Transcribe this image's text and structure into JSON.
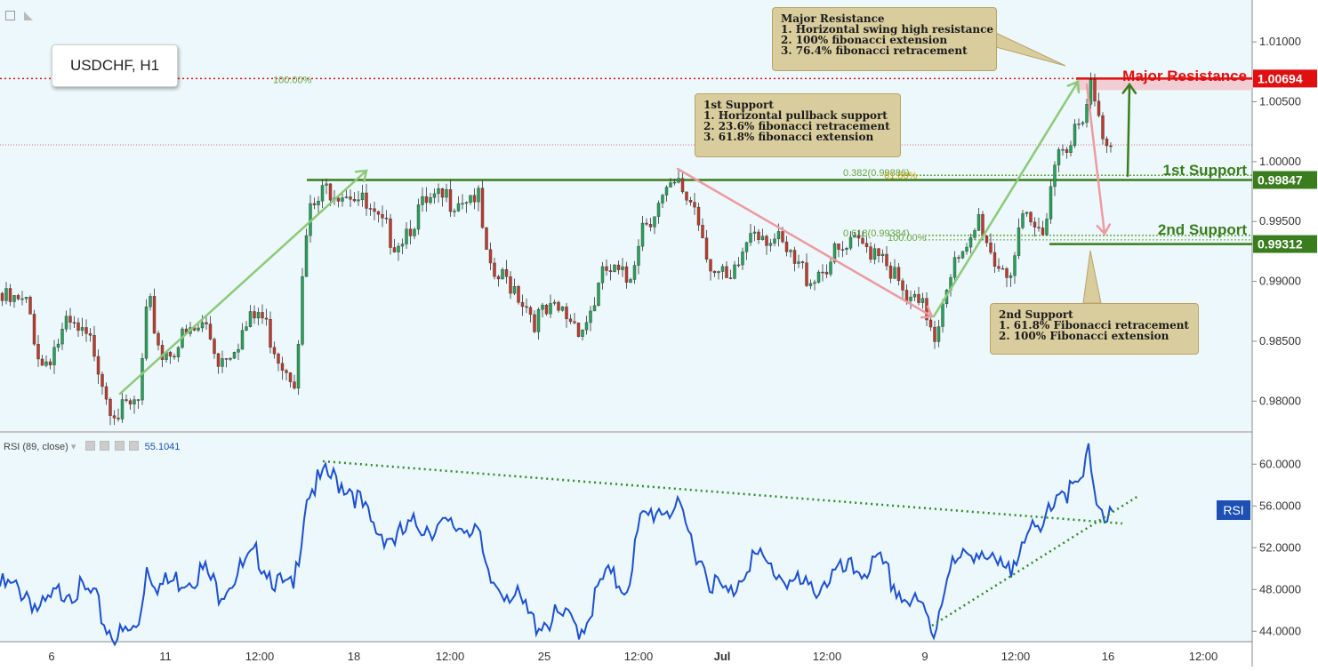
{
  "symbol": "USDCHF, H1",
  "colors": {
    "background": "#ecf8fb",
    "bull": "#26a35a",
    "bear": "#c0392b",
    "support_green": "#3a7d1e",
    "resistance_red": "#e01010",
    "fib_green": "#6aa343",
    "rsi_blue": "#1e50d0",
    "callout_bg": "#d9cc9d"
  },
  "annotations": {
    "major_resistance": {
      "label": "Major Resistance",
      "price_tag": "1.00694",
      "callout_title": "Major Resistance",
      "callout_lines": [
        "1. Horizontal swing high resistance",
        "2. 100% fibonacci extension",
        "3. 76.4% fibonacci retracement"
      ]
    },
    "first_support": {
      "label": "1st Support",
      "price_tag": "0.99847",
      "callout_title": "1st Support",
      "callout_lines": [
        "1. Horizontal pullback support",
        "2. 23.6% fibonacci retracement",
        "3. 61.8% fibonacci extension"
      ]
    },
    "second_support": {
      "label": "2nd Support",
      "price_tag": "0.99312",
      "callout_title": "2nd Support",
      "callout_lines": [
        "1. 61.8% Fibonacci retracement",
        "2. 100% Fibonacci extension"
      ]
    },
    "fib_labels": [
      "100.00%",
      "0.382(0.99886)",
      "61.80%",
      "0.618(0.99384)",
      "100.00%"
    ]
  },
  "rsi": {
    "legend_name": "RSI (89, close)",
    "legend_value": "55.1041",
    "tag": "RSI"
  },
  "chart_data": [
    {
      "type": "candlestick",
      "title": "USDCHF, H1",
      "x_ticks": [
        "6",
        "11",
        "12:00",
        "18",
        "12:00",
        "25",
        "12:00",
        "Jul",
        "12:00",
        "9",
        "12:00",
        "16",
        "12:00"
      ],
      "y_ticks": [
        "1.01000",
        "1.00500",
        "1.00000",
        "0.99500",
        "0.99000",
        "0.98500",
        "0.98000"
      ],
      "ylim": [
        0.9775,
        1.0135
      ],
      "price_path_knots": [
        [
          0,
          0.989
        ],
        [
          30,
          0.9885
        ],
        [
          45,
          0.9835
        ],
        [
          75,
          0.9868
        ],
        [
          105,
          0.985
        ],
        [
          120,
          0.9808
        ],
        [
          135,
          0.9795
        ],
        [
          155,
          0.9805
        ],
        [
          165,
          0.989
        ],
        [
          180,
          0.9845
        ],
        [
          230,
          0.987
        ],
        [
          245,
          0.984
        ],
        [
          290,
          0.988
        ],
        [
          315,
          0.984
        ],
        [
          330,
          0.9828
        ],
        [
          345,
          0.996
        ],
        [
          368,
          0.9985
        ],
        [
          395,
          0.9982
        ],
        [
          420,
          0.9955
        ],
        [
          445,
          0.994
        ],
        [
          470,
          0.9965
        ],
        [
          500,
          0.9975
        ],
        [
          535,
          0.998
        ],
        [
          548,
          0.991
        ],
        [
          575,
          0.9905
        ],
        [
          600,
          0.9875
        ],
        [
          630,
          0.988
        ],
        [
          655,
          0.9868
        ],
        [
          680,
          0.9915
        ],
        [
          705,
          0.9905
        ],
        [
          720,
          0.9955
        ],
        [
          740,
          0.997
        ],
        [
          760,
          0.9985
        ],
        [
          780,
          0.997
        ],
        [
          800,
          0.9915
        ],
        [
          820,
          0.99
        ],
        [
          845,
          0.9955
        ],
        [
          870,
          0.994
        ],
        [
          890,
          0.992
        ],
        [
          910,
          0.991
        ],
        [
          935,
          0.9925
        ],
        [
          960,
          0.9935
        ],
        [
          990,
          0.9935
        ],
        [
          1015,
          0.989
        ],
        [
          1040,
          0.988
        ],
        [
          1050,
          0.9862
        ],
        [
          1065,
          0.9915
        ],
        [
          1085,
          0.9925
        ],
        [
          1100,
          0.996
        ],
        [
          1115,
          0.9925
        ],
        [
          1135,
          0.9915
        ],
        [
          1150,
          0.9955
        ],
        [
          1170,
          0.9945
        ],
        [
          1180,
          0.999
        ],
        [
          1190,
          1.002
        ],
        [
          1205,
          1.003
        ],
        [
          1215,
          1.003
        ],
        [
          1225,
          1.0068
        ],
        [
          1235,
          1.0035
        ],
        [
          1250,
          1.0018
        ]
      ],
      "levels": {
        "major_resistance": 1.00694,
        "first_support": 0.99847,
        "second_support": 0.99312,
        "current_price": 1.0014,
        "fib_382": 0.99886,
        "fib_618": 0.99384
      }
    },
    {
      "type": "line",
      "title": "RSI (89, close)",
      "y_ticks": [
        "60.0000",
        "56.0000",
        "52.0000",
        "48.0000",
        "44.0000"
      ],
      "ylim": [
        43.0,
        63.0
      ],
      "series": [
        {
          "values_knots": [
            [
              0,
              49.0
            ],
            [
              30,
              48.5
            ],
            [
              45,
              46.5
            ],
            [
              75,
              49.0
            ],
            [
              105,
              48.0
            ],
            [
              120,
              45.0
            ],
            [
              135,
              44.2
            ],
            [
              155,
              45.0
            ],
            [
              165,
              51.0
            ],
            [
              180,
              49.0
            ],
            [
              230,
              50.5
            ],
            [
              245,
              48.5
            ],
            [
              290,
              52.0
            ],
            [
              315,
              49.0
            ],
            [
              330,
              48.5
            ],
            [
              345,
              58.0
            ],
            [
              368,
              59.5
            ],
            [
              395,
              58.5
            ],
            [
              420,
              54.5
            ],
            [
              445,
              53.5
            ],
            [
              470,
              55.0
            ],
            [
              500,
              54.5
            ],
            [
              535,
              55.0
            ],
            [
              548,
              49.5
            ],
            [
              575,
              48.5
            ],
            [
              600,
              45.5
            ],
            [
              630,
              46.0
            ],
            [
              655,
              45.0
            ],
            [
              680,
              50.0
            ],
            [
              705,
              49.0
            ],
            [
              720,
              55.0
            ],
            [
              740,
              56.5
            ],
            [
              760,
              56.5
            ],
            [
              780,
              53.0
            ],
            [
              800,
              49.5
            ],
            [
              820,
              48.0
            ],
            [
              845,
              52.0
            ],
            [
              870,
              50.5
            ],
            [
              890,
              49.5
            ],
            [
              910,
              48.5
            ],
            [
              935,
              50.0
            ],
            [
              960,
              50.5
            ],
            [
              990,
              51.0
            ],
            [
              1015,
              48.0
            ],
            [
              1040,
              46.5
            ],
            [
              1050,
              44.5
            ],
            [
              1065,
              50.5
            ],
            [
              1085,
              51.5
            ],
            [
              1100,
              53.0
            ],
            [
              1115,
              51.0
            ],
            [
              1135,
              50.0
            ],
            [
              1150,
              54.5
            ],
            [
              1170,
              53.5
            ],
            [
              1180,
              57.0
            ],
            [
              1190,
              58.5
            ],
            [
              1205,
              58.0
            ],
            [
              1215,
              58.5
            ],
            [
              1225,
              61.8
            ],
            [
              1235,
              57.0
            ],
            [
              1250,
              55.1
            ]
          ]
        }
      ]
    }
  ]
}
